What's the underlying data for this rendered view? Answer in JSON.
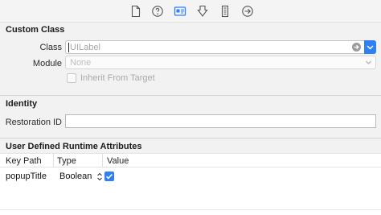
{
  "toolbar": {
    "icons": [
      "file-inspector-icon",
      "quick-help-icon",
      "identity-inspector-icon",
      "attributes-inspector-icon",
      "size-inspector-icon",
      "connections-inspector-icon"
    ]
  },
  "custom_class": {
    "title": "Custom Class",
    "class_label": "Class",
    "class_placeholder": "UILabel",
    "module_label": "Module",
    "module_placeholder": "None",
    "inherit_label": "Inherit From Target"
  },
  "identity": {
    "title": "Identity",
    "restoration_label": "Restoration ID",
    "restoration_value": ""
  },
  "runtime_attributes": {
    "title": "User Defined Runtime Attributes",
    "columns": [
      "Key Path",
      "Type",
      "Value"
    ],
    "rows": [
      {
        "key_path": "popupTitle",
        "type": "Boolean",
        "value_checked": true
      }
    ]
  },
  "colors": {
    "accent": "#2f7ff5",
    "section_bg": "#f2f2f2",
    "toolbar_bg": "#f4f4f4"
  }
}
